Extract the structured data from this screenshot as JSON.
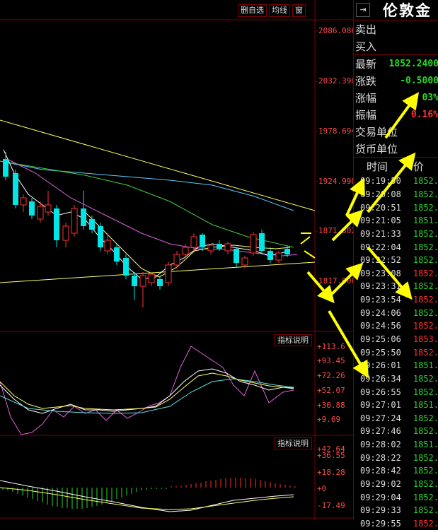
{
  "toolbar": {
    "delete_label": "删自选",
    "ma_label": "均线",
    "window_label": "窗"
  },
  "price_axis": [
    "2086.086",
    "2032.390",
    "1978.694",
    "1924.998",
    "1871.302",
    "1817.606"
  ],
  "indicator1": {
    "button": "指标说明",
    "axis": [
      "+113.6",
      "+93.45",
      "+72.26",
      "+52.07",
      "+30.88",
      "+9.69"
    ]
  },
  "indicator2": {
    "button": "指标说明",
    "axis": [
      "+42.64",
      "+36.55",
      "+18.28",
      "+0",
      "-17.49"
    ]
  },
  "quote": {
    "title": "伦敦金",
    "sell_label": "卖出",
    "buy_label": "买入",
    "last_label": "最新",
    "last_value": "1852.2400",
    "change_label": "涨跌",
    "change_value": "-0.5000",
    "pct_label": "涨幅",
    "pct_value": "03%",
    "amp_label": "振幅",
    "amp_value": "0.16%",
    "unit_label": "交易单位",
    "currency_label": "货币单位"
  },
  "ticks": {
    "col_time": "时间",
    "col_price": "价",
    "rows": [
      {
        "t": "09:19:50",
        "p": "1852.",
        "c": "#28d828"
      },
      {
        "t": "09:20:08",
        "p": "1852.",
        "c": "#28d828"
      },
      {
        "t": "09:20:51",
        "p": "1852.",
        "c": "#28d828"
      },
      {
        "t": "09:21:05",
        "p": "1851.",
        "c": "#28d828"
      },
      {
        "t": "09:21:33",
        "p": "1852.",
        "c": "#28d828"
      },
      {
        "t": "09:22:04",
        "p": "1852.",
        "c": "#28d828"
      },
      {
        "t": "09:22:52",
        "p": "1852.",
        "c": "#28d828"
      },
      {
        "t": "09:23:08",
        "p": "1852.",
        "c": "#ff3030"
      },
      {
        "t": "09:23:31",
        "p": "1852.",
        "c": "#28d828"
      },
      {
        "t": "09:23:54",
        "p": "1852.",
        "c": "#ff3030"
      },
      {
        "t": "09:24:06",
        "p": "1852.",
        "c": "#28d828"
      },
      {
        "t": "09:24:56",
        "p": "1852.",
        "c": "#ff3030"
      },
      {
        "t": "09:25:06",
        "p": "1853.",
        "c": "#ff3030"
      },
      {
        "t": "09:25:50",
        "p": "1852.",
        "c": "#ff3030"
      },
      {
        "t": "09:26:01",
        "p": "1851.",
        "c": "#28d828"
      },
      {
        "t": "09:26:34",
        "p": "1852.",
        "c": "#28d828"
      },
      {
        "t": "09:26:55",
        "p": "1852.",
        "c": "#28d828"
      },
      {
        "t": "09:27:01",
        "p": "1851.",
        "c": "#28d828"
      },
      {
        "t": "09:27:24",
        "p": "1852.",
        "c": "#28d828"
      },
      {
        "t": "09:27:46",
        "p": "1852.",
        "c": "#28d828"
      },
      {
        "t": "09:28:02",
        "p": "1851.",
        "c": "#28d828"
      },
      {
        "t": "09:28:22",
        "p": "1852.",
        "c": "#28d828"
      },
      {
        "t": "09:28:42",
        "p": "1852.",
        "c": "#28d828"
      },
      {
        "t": "09:29:02",
        "p": "1852.",
        "c": "#28d828"
      },
      {
        "t": "09:29:04",
        "p": "1852.",
        "c": "#28d828"
      },
      {
        "t": "09:29:33",
        "p": "1852.",
        "c": "#28d828"
      },
      {
        "t": "09:29:55",
        "p": "1852.",
        "c": "#ff3030"
      }
    ]
  },
  "colors": {
    "up": "#ff3030",
    "down": "#00e5e5",
    "grid": "#7a0000",
    "arrow": "#ffff00"
  }
}
